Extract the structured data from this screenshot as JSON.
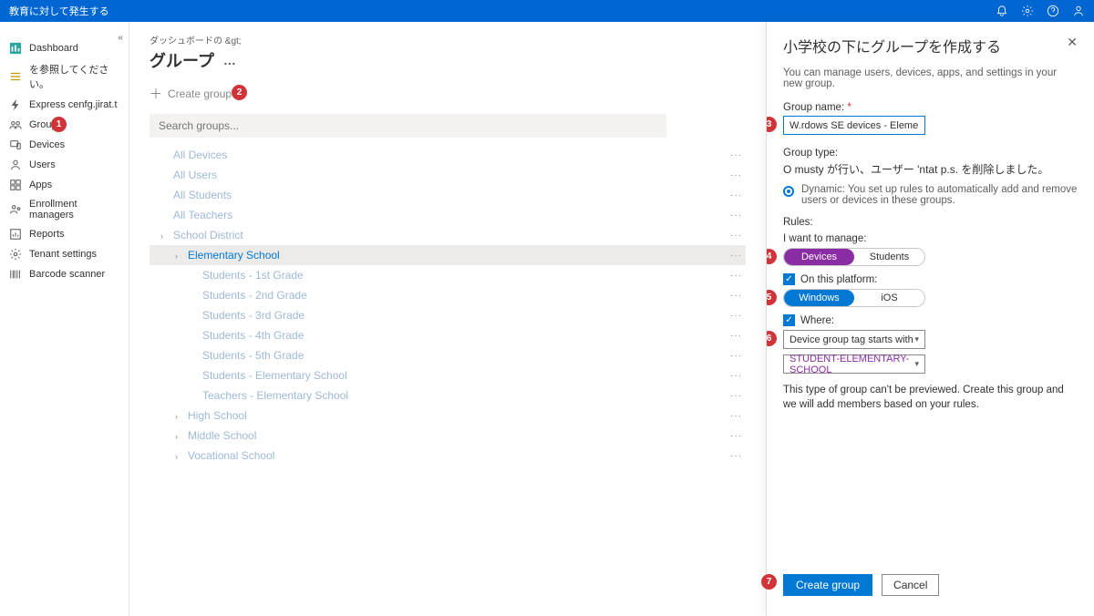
{
  "topbar": {
    "title": "教育に対して発生する"
  },
  "sidebar": {
    "items": [
      {
        "icon": "dashboard",
        "label": "Dashboard"
      },
      {
        "icon": "list",
        "label": "を参照してください。"
      },
      {
        "icon": "bolt",
        "label": "Express cenfg.jirat.t"
      },
      {
        "icon": "groups",
        "label": "Groups"
      },
      {
        "icon": "devices",
        "label": "Devices"
      },
      {
        "icon": "users",
        "label": "Users"
      },
      {
        "icon": "apps",
        "label": "Apps"
      },
      {
        "icon": "enroll",
        "label": "Enrollment managers"
      },
      {
        "icon": "reports",
        "label": "Reports"
      },
      {
        "icon": "tenant",
        "label": "Tenant settings"
      },
      {
        "icon": "barcode",
        "label": "Barcode scanner"
      }
    ]
  },
  "main": {
    "breadcrumb": "ダッシュボードの &gt;",
    "title": "グループ",
    "create_group": "Create group",
    "search_placeholder": "Search groups...",
    "tree": [
      {
        "label": "All Devices",
        "indent": 0,
        "chevron": false,
        "dim": true
      },
      {
        "label": "All Users",
        "indent": 0,
        "chevron": false,
        "dim": true
      },
      {
        "label": "All Students",
        "indent": 0,
        "chevron": false,
        "dim": true
      },
      {
        "label": "All Teachers",
        "indent": 0,
        "chevron": false,
        "dim": true
      },
      {
        "label": "School District",
        "indent": 0,
        "chevron": true,
        "dim": true
      },
      {
        "label": "Elementary School",
        "indent": 1,
        "chevron": true,
        "dim": false,
        "selected": true
      },
      {
        "label": "Students - 1st Grade",
        "indent": 2,
        "chevron": false,
        "dim": true
      },
      {
        "label": "Students - 2nd Grade",
        "indent": 2,
        "chevron": false,
        "dim": true
      },
      {
        "label": "Students - 3rd Grade",
        "indent": 2,
        "chevron": false,
        "dim": true
      },
      {
        "label": "Students - 4th Grade",
        "indent": 2,
        "chevron": false,
        "dim": true
      },
      {
        "label": "Students - 5th Grade",
        "indent": 2,
        "chevron": false,
        "dim": true
      },
      {
        "label": "Students - Elementary School",
        "indent": 2,
        "chevron": false,
        "dim": true
      },
      {
        "label": "Teachers - Elementary School",
        "indent": 2,
        "chevron": false,
        "dim": true
      },
      {
        "label": "High School",
        "indent": 1,
        "chevron": true,
        "dim": true
      },
      {
        "label": "Middle School",
        "indent": 1,
        "chevron": true,
        "dim": true
      },
      {
        "label": "Vocational School",
        "indent": 1,
        "chevron": true,
        "dim": true
      }
    ]
  },
  "panel": {
    "title": "小学校の下にグループを作成する",
    "desc": "You can manage users, devices, apps, and settings in your new group.",
    "group_name_label": "Group name:",
    "group_name_value": "W.rdows SE devices - Elementary",
    "group_type_label": "Group type:",
    "group_type_line": "O musty が行い、ユーザー 'ntat p.s. を削除しました。",
    "dynamic_label": "Dynamic: You set up rules to automatically add and remove users or devices in these groups.",
    "rules_label": "Rules:",
    "manage_label": "I want to manage:",
    "manage_opts": {
      "a": "Devices",
      "b": "Students"
    },
    "platform_check": "On this platform:",
    "platform_opts": {
      "a": "Windows",
      "b": "iOS"
    },
    "where_check": "Where:",
    "where_select": "Device group tag starts with",
    "where_value": "STUDENT-ELEMENTARY-SCHOOL",
    "note": "This type of group can't be previewed. Create this group and we will add members based on your rules.",
    "create_btn": "Create group",
    "cancel_btn": "Cancel"
  },
  "badges": {
    "b1": "1",
    "b2": "2",
    "b3": "3",
    "b4": "4",
    "b5": "5",
    "b6": "6",
    "b7": "7"
  }
}
